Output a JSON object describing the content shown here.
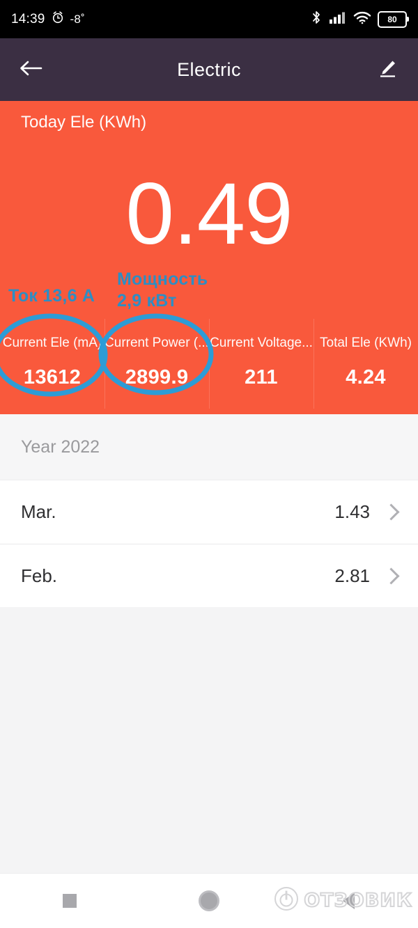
{
  "statusbar": {
    "time": "14:39",
    "alarm_icon": "alarm-clock-icon",
    "temperature": "-8˚",
    "bluetooth_icon": "bluetooth-icon",
    "signal_icon": "cellular-signal-icon",
    "wifi_icon": "wifi-icon",
    "battery_level": "80"
  },
  "appbar": {
    "back_icon": "back-arrow-icon",
    "title": "Electric",
    "edit_icon": "edit-pencil-icon"
  },
  "hero": {
    "label": "Today Ele (KWh)",
    "value": "0.49",
    "background_color": "#f9593c",
    "stats": [
      {
        "label": "Current Ele (mA)",
        "value": "13612"
      },
      {
        "label": "Current Power (...",
        "value": "2899.9"
      },
      {
        "label": "Current Voltage...",
        "value": "211"
      },
      {
        "label": "Total Ele (KWh)",
        "value": "4.24"
      }
    ]
  },
  "annotations": {
    "color": "#2d8ec4",
    "current_text": "Ток 13,6 А",
    "power_text_line1": "Мощность",
    "power_text_line2": "2,9 кВт"
  },
  "history": {
    "year_header": "Year 2022",
    "rows": [
      {
        "month": "Mar.",
        "value": "1.43",
        "chevron_icon": "chevron-right-icon"
      },
      {
        "month": "Feb.",
        "value": "2.81",
        "chevron_icon": "chevron-right-icon"
      }
    ]
  },
  "navbar": {
    "recents_icon": "recents-square-icon",
    "home_icon": "home-circle-icon",
    "back_icon": "back-triangle-icon"
  },
  "watermark": {
    "logo_icon": "power-circle-logo-icon",
    "text": "ОТЗОВИК"
  }
}
